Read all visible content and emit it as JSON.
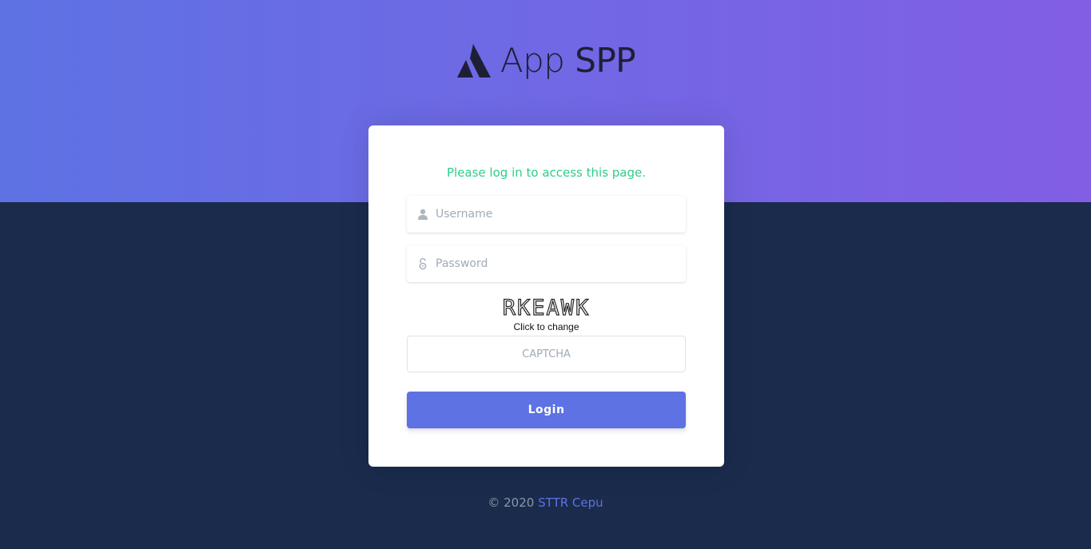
{
  "brand": {
    "name_light": "App",
    "name_strong": "SPP",
    "logo_icon": "triangle-mountain-logo"
  },
  "login": {
    "notice": "Please log in to access this page.",
    "username_placeholder": "Username",
    "password_placeholder": "Password",
    "captcha_code": "RKEAWK",
    "captcha_hint": "Click to change",
    "captcha_placeholder": "CAPTCHA",
    "submit_label": "Login"
  },
  "footer": {
    "copyright": "© 2020",
    "link_text": "STTR Cepu"
  },
  "colors": {
    "hero_start": "#5e72e4",
    "hero_end": "#825ee4",
    "background": "#1a2b4c",
    "primary": "#5e72e4",
    "success": "#2dce89"
  }
}
